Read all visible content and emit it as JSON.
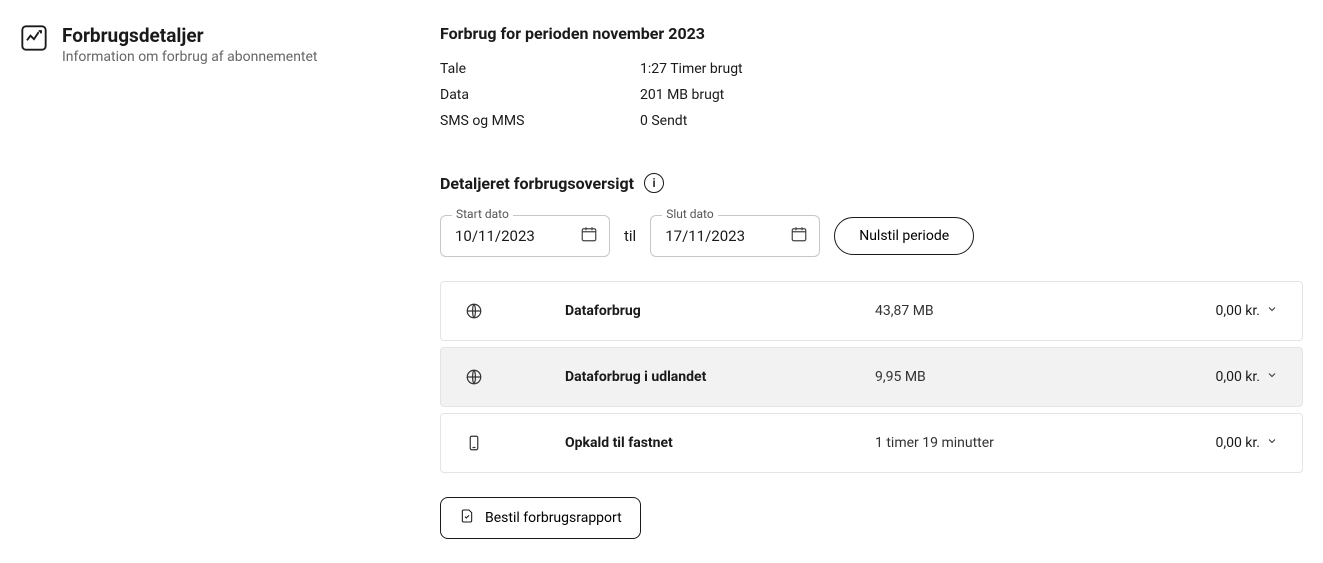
{
  "sidebar": {
    "title": "Forbrugsdetaljer",
    "subtitle": "Information om forbrug af abonnementet"
  },
  "summary": {
    "heading": "Forbrug for perioden november 2023",
    "rows": [
      {
        "label": "Tale",
        "value": "1:27 Timer brugt"
      },
      {
        "label": "Data",
        "value": "201 MB brugt"
      },
      {
        "label": "SMS og MMS",
        "value": "0 Sendt"
      }
    ]
  },
  "detailed": {
    "heading": "Detaljeret forbrugsoversigt",
    "start_legend": "Start dato",
    "start_value": "10/11/2023",
    "til_label": "til",
    "end_legend": "Slut dato",
    "end_value": "17/11/2023",
    "reset_label": "Nulstil periode",
    "rows": [
      {
        "title": "Dataforbrug",
        "amount": "43,87 MB",
        "price": "0,00 kr."
      },
      {
        "title": "Dataforbrug i udlandet",
        "amount": "9,95 MB",
        "price": "0,00 kr."
      },
      {
        "title": "Opkald til fastnet",
        "amount": "1 timer 19 minutter",
        "price": "0,00 kr."
      }
    ]
  },
  "report_button": "Bestil forbrugsrapport"
}
